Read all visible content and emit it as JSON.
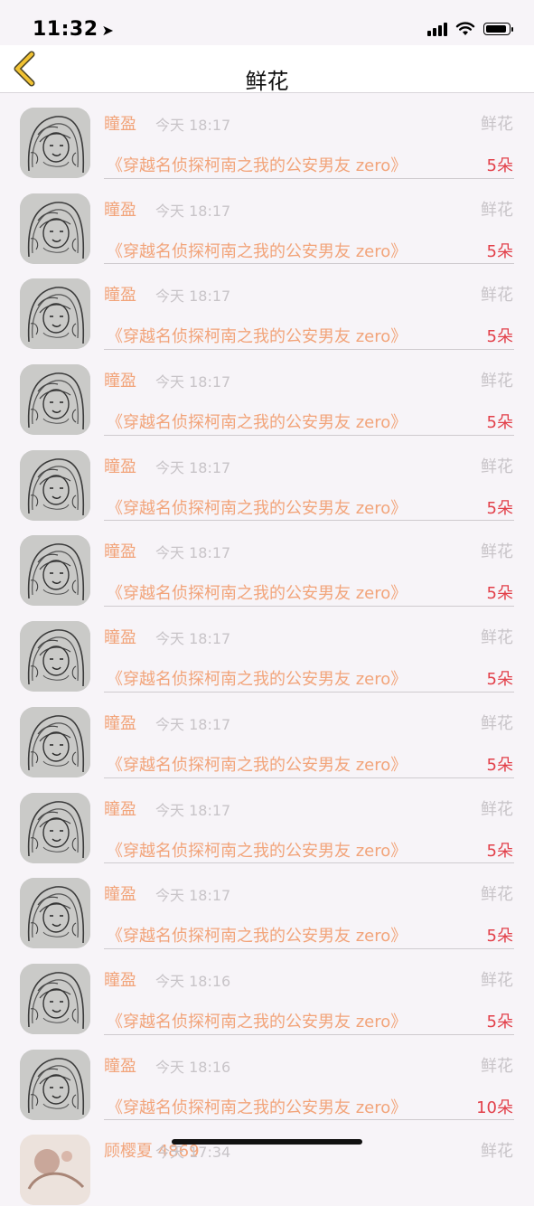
{
  "status_bar": {
    "time": "11:32",
    "location_arrow": "➤"
  },
  "nav": {
    "title": "鲜花"
  },
  "rows": [
    {
      "name": "瞳盈",
      "time": "今天 18:17",
      "type": "鲜花",
      "book": "《穿越名侦探柯南之我的公安男友 zero》",
      "count": "5朵"
    },
    {
      "name": "瞳盈",
      "time": "今天 18:17",
      "type": "鲜花",
      "book": "《穿越名侦探柯南之我的公安男友 zero》",
      "count": "5朵"
    },
    {
      "name": "瞳盈",
      "time": "今天 18:17",
      "type": "鲜花",
      "book": "《穿越名侦探柯南之我的公安男友 zero》",
      "count": "5朵"
    },
    {
      "name": "瞳盈",
      "time": "今天 18:17",
      "type": "鲜花",
      "book": "《穿越名侦探柯南之我的公安男友 zero》",
      "count": "5朵"
    },
    {
      "name": "瞳盈",
      "time": "今天 18:17",
      "type": "鲜花",
      "book": "《穿越名侦探柯南之我的公安男友 zero》",
      "count": "5朵"
    },
    {
      "name": "瞳盈",
      "time": "今天 18:17",
      "type": "鲜花",
      "book": "《穿越名侦探柯南之我的公安男友 zero》",
      "count": "5朵"
    },
    {
      "name": "瞳盈",
      "time": "今天 18:17",
      "type": "鲜花",
      "book": "《穿越名侦探柯南之我的公安男友 zero》",
      "count": "5朵"
    },
    {
      "name": "瞳盈",
      "time": "今天 18:17",
      "type": "鲜花",
      "book": "《穿越名侦探柯南之我的公安男友 zero》",
      "count": "5朵"
    },
    {
      "name": "瞳盈",
      "time": "今天 18:17",
      "type": "鲜花",
      "book": "《穿越名侦探柯南之我的公安男友 zero》",
      "count": "5朵"
    },
    {
      "name": "瞳盈",
      "time": "今天 18:17",
      "type": "鲜花",
      "book": "《穿越名侦探柯南之我的公安男友 zero》",
      "count": "5朵"
    },
    {
      "name": "瞳盈",
      "time": "今天 18:16",
      "type": "鲜花",
      "book": "《穿越名侦探柯南之我的公安男友 zero》",
      "count": "5朵"
    },
    {
      "name": "瞳盈",
      "time": "今天 18:16",
      "type": "鲜花",
      "book": "《穿越名侦探柯南之我的公安男友 zero》",
      "count": "10朵"
    },
    {
      "name": "顾樱夏 4869",
      "time": "今天 17:34",
      "type": "鲜花",
      "book": "",
      "count": ""
    }
  ],
  "colors": {
    "accent_orange": "#f2a47a",
    "count_red": "#e2404a",
    "muted_gray": "#c8c4c8",
    "back_arrow_yellow": "#f1c232"
  },
  "icons": {
    "back": "chevron-left-icon",
    "avatar": "sketch-portrait-avatar"
  }
}
